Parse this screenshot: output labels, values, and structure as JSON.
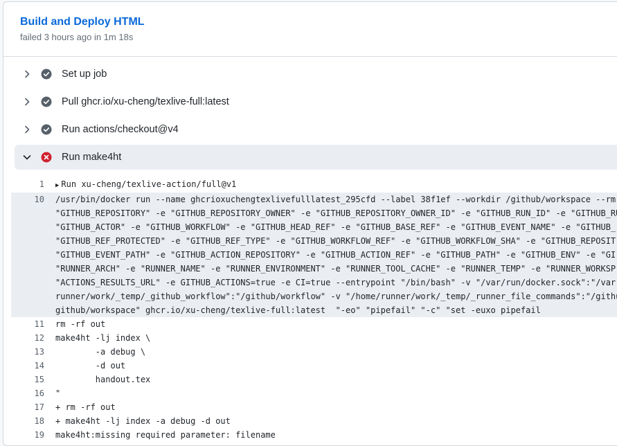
{
  "job": {
    "title": "Build and Deploy HTML",
    "status": "failed 3 hours ago in 1m 18s"
  },
  "colors": {
    "link": "#0969da",
    "success": "#57606a",
    "failure": "#cf222e"
  },
  "steps": [
    {
      "label": "Set up job",
      "status": "success",
      "expanded": false
    },
    {
      "label": "Pull ghcr.io/xu-cheng/texlive-full:latest",
      "status": "success",
      "expanded": false
    },
    {
      "label": "Run actions/checkout@v4",
      "status": "success",
      "expanded": false
    },
    {
      "label": "Run make4ht",
      "status": "failure",
      "expanded": true
    }
  ],
  "log": [
    {
      "num": "1",
      "text": "Run xu-cheng/texlive-action/full@v1",
      "group": true
    },
    {
      "num": "10",
      "text": "/usr/bin/docker run --name ghcrioxuchengtexlivefulllatest_295cfd --label 38f1ef --workdir /github/workspace --rm",
      "highlight": true
    },
    {
      "num": "",
      "text": "\"GITHUB_REPOSITORY\" -e \"GITHUB_REPOSITORY_OWNER\" -e \"GITHUB_REPOSITORY_OWNER_ID\" -e \"GITHUB_RUN_ID\" -e \"GITHUB_RU",
      "highlight": true
    },
    {
      "num": "",
      "text": "\"GITHUB_ACTOR\" -e \"GITHUB_WORKFLOW\" -e \"GITHUB_HEAD_REF\" -e \"GITHUB_BASE_REF\" -e \"GITHUB_EVENT_NAME\" -e \"GITHUB_",
      "highlight": true
    },
    {
      "num": "",
      "text": "\"GITHUB_REF_PROTECTED\" -e \"GITHUB_REF_TYPE\" -e \"GITHUB_WORKFLOW_REF\" -e \"GITHUB_WORKFLOW_SHA\" -e \"GITHUB_REPOSIT",
      "highlight": true
    },
    {
      "num": "",
      "text": "\"GITHUB_EVENT_PATH\" -e \"GITHUB_ACTION_REPOSITORY\" -e \"GITHUB_ACTION_REF\" -e \"GITHUB_PATH\" -e \"GITHUB_ENV\" -e \"GI",
      "highlight": true
    },
    {
      "num": "",
      "text": "\"RUNNER_ARCH\" -e \"RUNNER_NAME\" -e \"RUNNER_ENVIRONMENT\" -e \"RUNNER_TOOL_CACHE\" -e \"RUNNER_TEMP\" -e \"RUNNER_WORKSP",
      "highlight": true
    },
    {
      "num": "",
      "text": "\"ACTIONS_RESULTS_URL\" -e GITHUB_ACTIONS=true -e CI=true --entrypoint \"/bin/bash\" -v \"/var/run/docker.sock\":\"/var",
      "highlight": true
    },
    {
      "num": "",
      "text": "runner/work/_temp/_github_workflow\":\"/github/workflow\" -v \"/home/runner/work/_temp/_runner_file_commands\":\"/githu",
      "highlight": true
    },
    {
      "num": "",
      "text": "github/workspace\" ghcr.io/xu-cheng/texlive-full:latest  \"-eo\" \"pipefail\" \"-c\" \"set -euxo pipefail",
      "highlight": true
    },
    {
      "num": "11",
      "text": "rm -rf out"
    },
    {
      "num": "12",
      "text": "make4ht -lj index \\"
    },
    {
      "num": "13",
      "text": "        -a debug \\"
    },
    {
      "num": "14",
      "text": "        -d out"
    },
    {
      "num": "15",
      "text": "        handout.tex"
    },
    {
      "num": "16",
      "text": "\""
    },
    {
      "num": "17",
      "text": "+ rm -rf out"
    },
    {
      "num": "18",
      "text": "+ make4ht -lj index -a debug -d out"
    },
    {
      "num": "19",
      "text": "make4ht:missing required parameter: filename"
    }
  ]
}
